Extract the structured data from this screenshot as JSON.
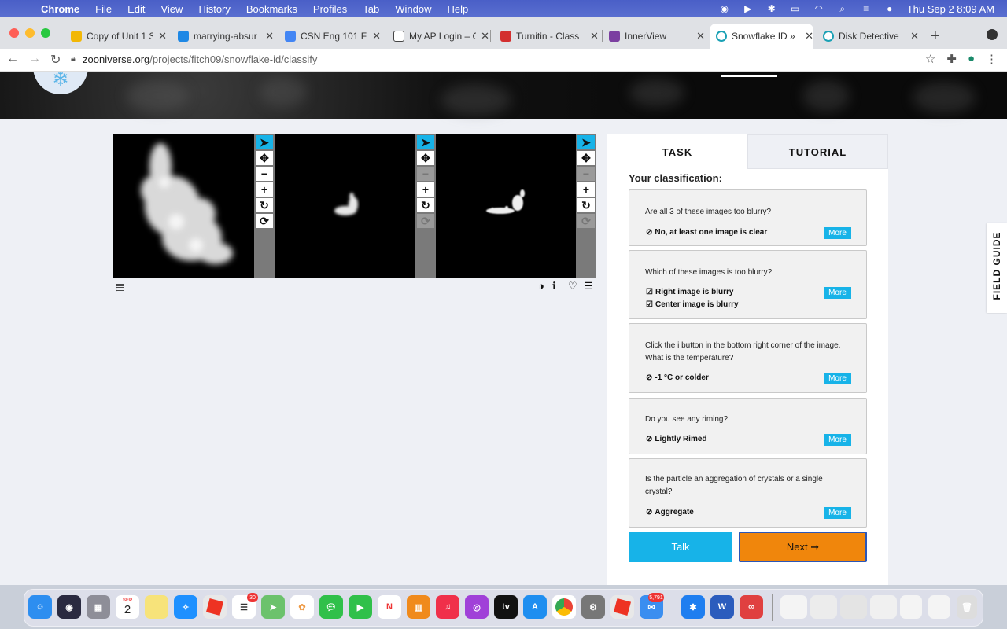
{
  "menubar": {
    "app": "Chrome",
    "items": [
      "File",
      "Edit",
      "View",
      "History",
      "Bookmarks",
      "Profiles",
      "Tab",
      "Window",
      "Help"
    ],
    "clock": "Thu Sep 2  8:09 AM"
  },
  "tabs": [
    {
      "title": "Copy of Unit 1 S",
      "color": "#f2b705"
    },
    {
      "title": "marrying-absur",
      "color": "#1e88e5"
    },
    {
      "title": "CSN Eng 101 Fa",
      "color": "#4285f4"
    },
    {
      "title": "My AP Login – C",
      "color": "#444444"
    },
    {
      "title": "Turnitin - Class",
      "color": "#d32f2f"
    },
    {
      "title": "InnerView",
      "color": "#7b3fa0"
    },
    {
      "title": "Snowflake ID »",
      "color": "#1aa1b5"
    },
    {
      "title": "Disk Detective",
      "color": "#1aa1b5"
    }
  ],
  "address": {
    "host": "zooniverse.org",
    "path": "/projects/fitch09/snowflake-id/classify"
  },
  "panel": {
    "tab_task": "TASK",
    "tab_tutorial": "TUTORIAL",
    "heading": "Your classification:",
    "more_label": "More",
    "questions": [
      {
        "q": "Are all 3 of these images too blurry?",
        "answers": [
          "No, at least one image is clear"
        ]
      },
      {
        "q": "Which of these images is too blurry?",
        "answers": [
          "Right image is blurry",
          "Center image is blurry"
        ]
      },
      {
        "q": "Click the i button in the bottom right corner of the image. What is the temperature?",
        "answers": [
          "-1 °C or colder"
        ]
      },
      {
        "q": "Do you see any riming?",
        "answers": [
          "Lightly Rimed"
        ]
      },
      {
        "q": "Is the particle an aggregation of crystals or a single crystal?",
        "answers": [
          "Aggregate"
        ]
      }
    ],
    "talk_label": "Talk",
    "next_label": "Next ➞"
  },
  "field_guide": "FIELD GUIDE",
  "dock": {
    "calendar_month": "SEP",
    "calendar_day": "2",
    "reminders_badge": "30",
    "mail_badge": "5,791",
    "tv_label": "tv"
  }
}
